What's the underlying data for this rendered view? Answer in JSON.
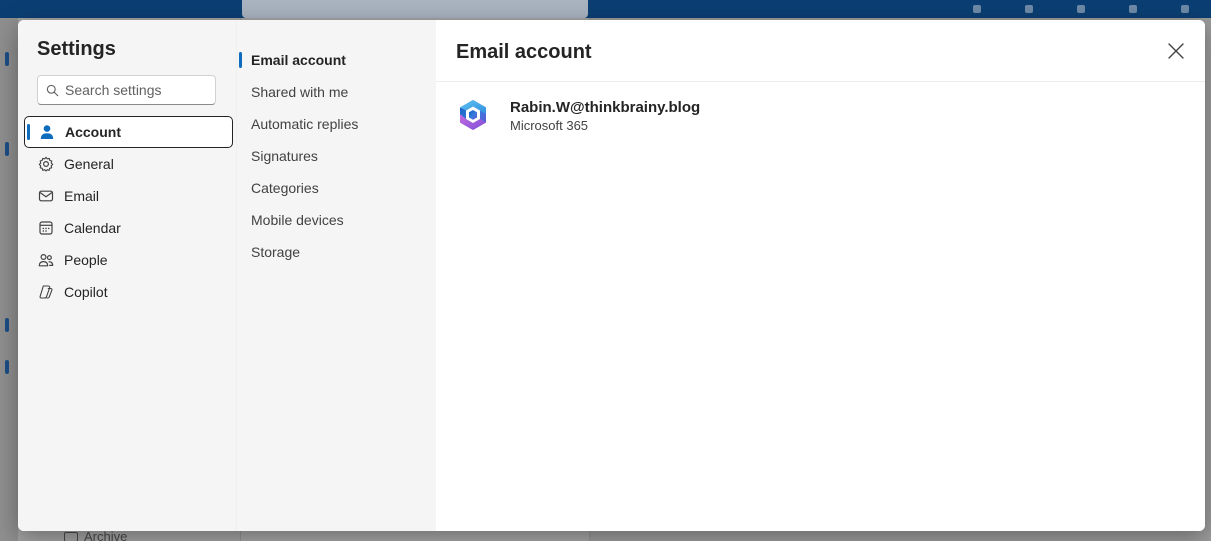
{
  "background": {
    "archive_label": "Archive"
  },
  "settings": {
    "title": "Settings",
    "search": {
      "placeholder": "Search settings"
    },
    "nav_items": [
      {
        "label": "Account",
        "icon": "person-icon",
        "active": true
      },
      {
        "label": "General",
        "icon": "gear-icon",
        "active": false
      },
      {
        "label": "Email",
        "icon": "envelope-icon",
        "active": false
      },
      {
        "label": "Calendar",
        "icon": "calendar-icon",
        "active": false
      },
      {
        "label": "People",
        "icon": "people-icon",
        "active": false
      },
      {
        "label": "Copilot",
        "icon": "copilot-icon",
        "active": false
      }
    ],
    "sub_items": [
      {
        "label": "Email account",
        "active": true
      },
      {
        "label": "Shared with me",
        "active": false
      },
      {
        "label": "Automatic replies",
        "active": false
      },
      {
        "label": "Signatures",
        "active": false
      },
      {
        "label": "Categories",
        "active": false
      },
      {
        "label": "Mobile devices",
        "active": false
      },
      {
        "label": "Storage",
        "active": false
      }
    ]
  },
  "main": {
    "title": "Email account",
    "account": {
      "email": "Rabin.W@thinkbrainy.blog",
      "plan": "Microsoft 365",
      "icon": "microsoft-365-icon"
    }
  },
  "colors": {
    "accent": "#0f6cbd",
    "topbar": "#0b3f73"
  }
}
